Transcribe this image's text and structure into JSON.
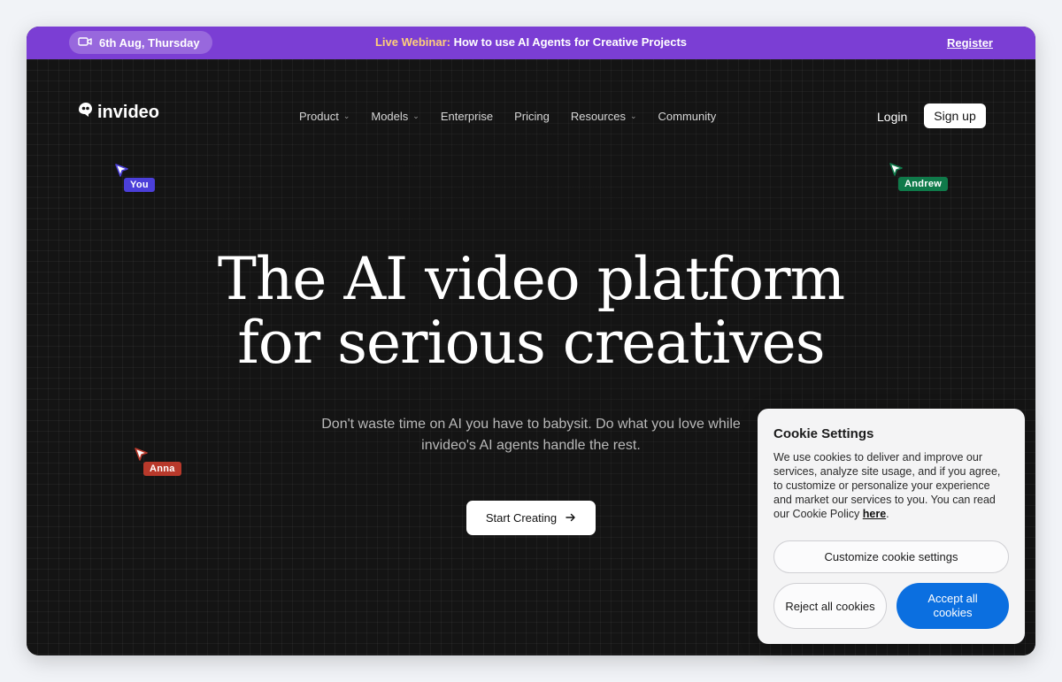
{
  "announcement": {
    "date": "6th Aug, Thursday",
    "webinar_highlight": "Live Webinar:",
    "webinar_text": " How to use AI Agents for Creative Projects",
    "register": "Register"
  },
  "header": {
    "logo": "invideo",
    "nav": [
      {
        "label": "Product",
        "has_dropdown": true
      },
      {
        "label": "Models",
        "has_dropdown": true
      },
      {
        "label": "Enterprise",
        "has_dropdown": false
      },
      {
        "label": "Pricing",
        "has_dropdown": false
      },
      {
        "label": "Resources",
        "has_dropdown": true
      },
      {
        "label": "Community",
        "has_dropdown": false
      }
    ],
    "login": "Login",
    "signup": "Sign up"
  },
  "cursors": [
    {
      "label": "You",
      "color": "#4b3fd9"
    },
    {
      "label": "Andrew",
      "color": "#0f7a4a"
    },
    {
      "label": "Anna",
      "color": "#b8392b"
    }
  ],
  "hero": {
    "headline_line1": "The AI video platform",
    "headline_line2": "for serious creatives",
    "sub_line1": "Don't waste time on AI you have to babysit. Do what you love while",
    "sub_line2": "invideo's AI agents handle the rest.",
    "cta": "Start Creating"
  },
  "cookie": {
    "title": "Cookie Settings",
    "body": "We use cookies to deliver and improve our services, analyze site usage, and if you agree, to customize or personalize your experience and market our services to you. You can read our Cookie Policy ",
    "link": "here",
    "customize": "Customize cookie settings",
    "reject": "Reject all cookies",
    "accept": "Accept all cookies"
  },
  "colors": {
    "announcement_bar": "#7b3ed4",
    "accept_button": "#0b6fe0",
    "hero_background": "#141414"
  }
}
